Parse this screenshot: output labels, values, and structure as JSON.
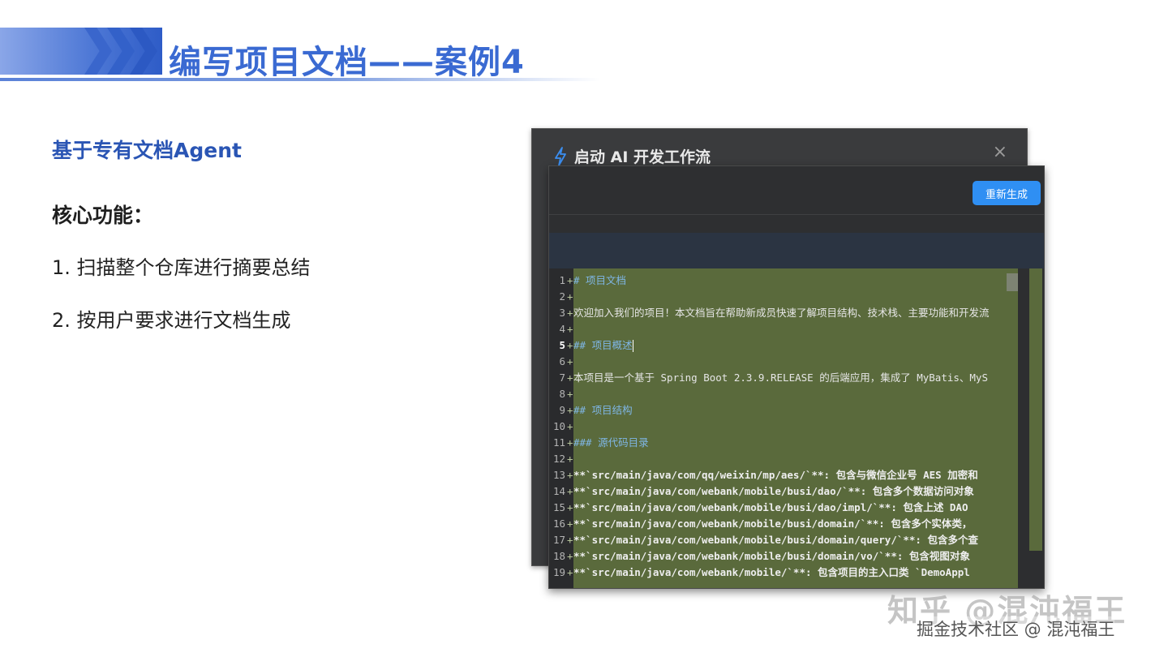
{
  "slide": {
    "title": "编写项目文档——案例4",
    "subtitle": "基于专有文档Agent",
    "section_heading": "核心功能：",
    "items": [
      "1. 扫描整个仓库进行摘要总结",
      "2. 按用户要求进行文档生成"
    ]
  },
  "dialog": {
    "title": "启动 AI 开发工作流",
    "icon": "lightning-bolt-icon",
    "close_glyph": "×",
    "regenerate_label": "重新生成",
    "accent_color": "#2f8ff3",
    "diff_added_bg": "#5a6a3c"
  },
  "editor": {
    "active_line": 5,
    "lines": [
      {
        "n": "1",
        "marker": "+",
        "text": "# 项目文档",
        "style": "heading"
      },
      {
        "n": "2",
        "marker": "+",
        "text": "",
        "style": "plain"
      },
      {
        "n": "3",
        "marker": "+",
        "text": "欢迎加入我们的项目！本文档旨在帮助新成员快速了解项目结构、技术栈、主要功能和开发流",
        "style": "plain"
      },
      {
        "n": "4",
        "marker": "+",
        "text": "",
        "style": "plain"
      },
      {
        "n": "5",
        "marker": "+",
        "text": "## 项目概述",
        "style": "heading"
      },
      {
        "n": "6",
        "marker": "+",
        "text": "",
        "style": "plain"
      },
      {
        "n": "7",
        "marker": "+",
        "text": "本项目是一个基于 Spring Boot 2.3.9.RELEASE 的后端应用，集成了 MyBatis、MyS",
        "style": "plain"
      },
      {
        "n": "8",
        "marker": "+",
        "text": "",
        "style": "plain"
      },
      {
        "n": "9",
        "marker": "+",
        "text": "## 项目结构",
        "style": "heading"
      },
      {
        "n": "10",
        "marker": "+",
        "text": "",
        "style": "plain"
      },
      {
        "n": "11",
        "marker": "+",
        "text": "### 源代码目录",
        "style": "heading"
      },
      {
        "n": "12",
        "marker": "+",
        "text": "",
        "style": "plain"
      },
      {
        "n": "13",
        "marker": "+",
        "text": "  **`src/main/java/com/qq/weixin/mp/aes/`**: 包含与微信企业号 AES 加密和",
        "style": "bold"
      },
      {
        "n": "14",
        "marker": "+",
        "text": "  **`src/main/java/com/webank/mobile/busi/dao/`**: 包含多个数据访问对象",
        "style": "bold"
      },
      {
        "n": "15",
        "marker": "+",
        "text": "  **`src/main/java/com/webank/mobile/busi/dao/impl/`**: 包含上述 DAO",
        "style": "bold"
      },
      {
        "n": "16",
        "marker": "+",
        "text": "  **`src/main/java/com/webank/mobile/busi/domain/`**: 包含多个实体类，",
        "style": "bold"
      },
      {
        "n": "17",
        "marker": "+",
        "text": "  **`src/main/java/com/webank/mobile/busi/domain/query/`**: 包含多个查",
        "style": "bold"
      },
      {
        "n": "18",
        "marker": "+",
        "text": "  **`src/main/java/com/webank/mobile/busi/domain/vo/`**: 包含视图对象",
        "style": "bold"
      },
      {
        "n": "19",
        "marker": "+",
        "text": "  **`src/main/java/com/webank/mobile/`**: 包含项目的主入口类 `DemoAppl",
        "style": "bold"
      }
    ]
  },
  "watermarks": {
    "zhihu": "知乎 @混沌福王",
    "juejin": "掘金技术社区 @ 混沌福王"
  }
}
